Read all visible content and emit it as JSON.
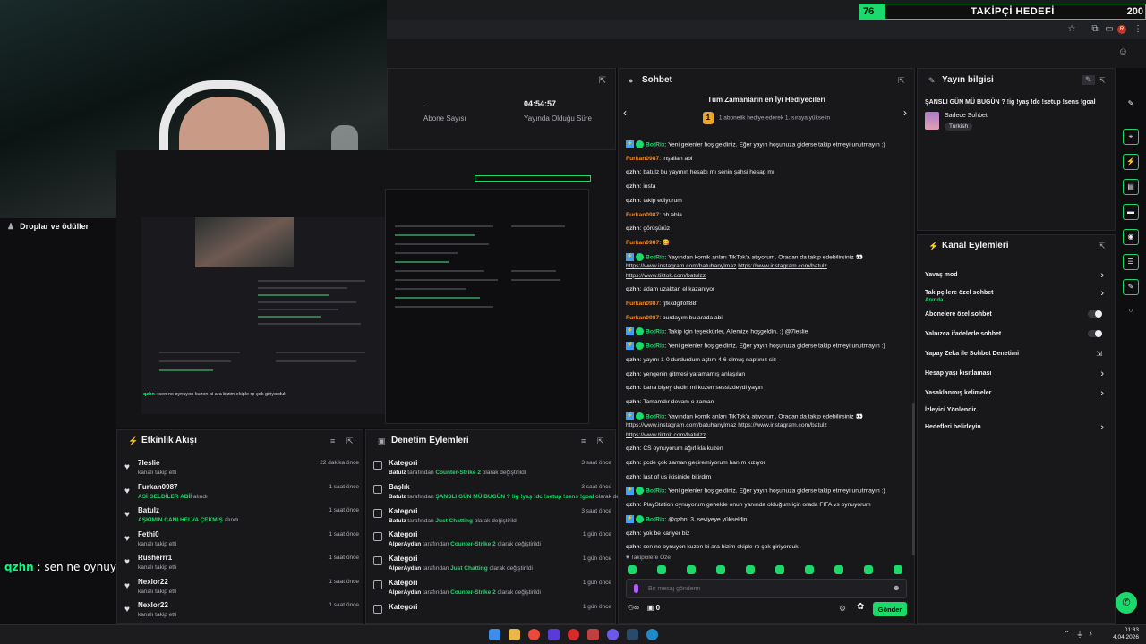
{
  "follow_goal": {
    "current": "76",
    "title": "TAKİPÇİ HEDEFİ",
    "target": "200"
  },
  "drops_label": "Droplar ve ödüller",
  "overlay_chat": {
    "user": "qzhn",
    "text": " : sen ne oynuyon kuzen bi ara bizim ekiple rp çok giriyorduk"
  },
  "stats": {
    "subs_value": "-",
    "subs_label": "Abone Sayısı",
    "live_value": "04:54:57",
    "live_label": "Yayında Olduğu Süre"
  },
  "activity": {
    "title": "Etkinlik Akışı",
    "items": [
      {
        "name": "7leslie",
        "sub": "kanalı takip etti",
        "highlight": "",
        "time": "22 dakika önce"
      },
      {
        "name": "Furkan0987",
        "sub": " alındı",
        "highlight": "ASİ GELDİLER ABİİ",
        "time": "1 saat önce"
      },
      {
        "name": "Batulz",
        "sub": " alındı",
        "highlight": "AŞKIMIN CANI HELVA ÇEKMİŞ",
        "time": "1 saat önce"
      },
      {
        "name": "Fethi0",
        "sub": "kanalı takip etti",
        "highlight": "",
        "time": "1 saat önce"
      },
      {
        "name": "Rusherrr1",
        "sub": "kanalı takip etti",
        "highlight": "",
        "time": "1 saat önce"
      },
      {
        "name": "Nexlor22",
        "sub": "kanalı takip etti",
        "highlight": "",
        "time": "1 saat önce"
      },
      {
        "name": "Nexlor22",
        "sub": "kanalı takip etti",
        "highlight": "",
        "time": "1 saat önce"
      }
    ]
  },
  "moderation": {
    "title": "Denetim Eylemleri",
    "items": [
      {
        "kind": "Kategori",
        "actor": "Batulz",
        "mid": " tarafından ",
        "value": "Counter-Strike 2",
        "tail": " olarak değiştirildi",
        "time": "3 saat önce"
      },
      {
        "kind": "Başlık",
        "actor": "Batulz",
        "mid": " tarafından ",
        "value": "ŞANSLI GÜN MÜ BUGÜN ? !ig !yaş !dc !setup !sens !goal",
        "tail": " olarak değiştirildi",
        "time": "3 saat önce"
      },
      {
        "kind": "Kategori",
        "actor": "Batulz",
        "mid": " tarafından ",
        "value": "Just Chatting",
        "tail": " olarak değiştirildi",
        "time": "3 saat önce"
      },
      {
        "kind": "Kategori",
        "actor": "AlperAydan",
        "mid": " tarafından ",
        "value": "Counter-Strike 2",
        "tail": " olarak değiştirildi",
        "time": "1 gün önce"
      },
      {
        "kind": "Kategori",
        "actor": "AlperAydan",
        "mid": " tarafından ",
        "value": "Just Chatting",
        "tail": " olarak değiştirildi",
        "time": "1 gün önce"
      },
      {
        "kind": "Kategori",
        "actor": "AlperAydan",
        "mid": " tarafından ",
        "value": "Counter-Strike 2",
        "tail": " olarak değiştirildi",
        "time": "1 gün önce"
      },
      {
        "kind": "Kategori",
        "actor": "",
        "mid": "",
        "value": "",
        "tail": "",
        "time": "1 gün önce"
      }
    ]
  },
  "chat": {
    "title": "Sohbet",
    "top_gifters": "Tüm Zamanların en İyi Hediyecileri",
    "gift_rank": "1",
    "gift_text": "1 abonelik hediye ederek 1. sıraya yükselin",
    "sub_only": "Takipçilere Özel",
    "input_placeholder": "Bir mesaj gönderin",
    "points": "0",
    "send_label": "Gönder",
    "messages": [
      {
        "u": "BotRix",
        "t": ": Yeni gelenler hoş geldiniz. Eğer yayın hoşunuza giderse takip etmeyi unutmayın :)",
        "c": "bot"
      },
      {
        "u": "Furkan0987",
        "t": ": inşallah abi",
        "c": "fur"
      },
      {
        "u": "qzhn",
        "t": ": batulz bu yayının hesabı mı senin şahsi hesap mı",
        "c": "qz"
      },
      {
        "u": "qzhn",
        "t": ": insta",
        "c": "qz"
      },
      {
        "u": "qzhn",
        "t": ": takip ediyorum",
        "c": "qz"
      },
      {
        "u": "Furkan0987",
        "t": ": bb abla",
        "c": "fur"
      },
      {
        "u": "qzhn",
        "t": ": görüşürüz",
        "c": "qz"
      },
      {
        "u": "Furkan0987",
        "t": ": 😋",
        "c": "fur"
      },
      {
        "u": "BotRix",
        "t": ": Yayından komik anları TikTok'a atıyorum. Oradan da takip edebilirsiniz 👀",
        "c": "bot",
        "links": [
          "https://www.instagram.com/batuhanylmaz",
          "https://www.instagram.com/batulz",
          "https://www.tiktok.com/batulzz"
        ]
      },
      {
        "u": "qzhn",
        "t": ": adam uzaktan el kazanıyor",
        "c": "qz"
      },
      {
        "u": "Furkan0987",
        "t": ": fjfkkdglfoff88f",
        "c": "fur"
      },
      {
        "u": "Furkan0987",
        "t": ": burdayım bu arada abi",
        "c": "fur"
      },
      {
        "u": "BotRix",
        "t": ": Takip için teşekkürler, Ailemize hoşgeldin. :) @7leslie",
        "c": "bot"
      },
      {
        "u": "BotRix",
        "t": ": Yeni gelenler hoş geldiniz. Eğer yayın hoşunuza giderse takip etmeyi unutmayın :)",
        "c": "bot"
      },
      {
        "u": "qzhn",
        "t": ": yayını 1-0 durdurdum açtım 4-6 olmuş naptınız siz",
        "c": "qz"
      },
      {
        "u": "qzhn",
        "t": ": yengenin gitmesi yaramamış anlaşılan",
        "c": "qz"
      },
      {
        "u": "qzhn",
        "t": ": bana bişey dedin mi kuzen sessizdeydi yayın",
        "c": "qz"
      },
      {
        "u": "qzhn",
        "t": ": Tamamdır devam o zaman",
        "c": "qz"
      },
      {
        "u": "BotRix",
        "t": ": Yayından komik anları TikTok'a atıyorum. Oradan da takip edebilirsiniz 👀",
        "c": "bot",
        "links": [
          "https://www.instagram.com/batuhanylmaz",
          "https://www.instagram.com/batulz",
          "https://www.tiktok.com/batulzz"
        ]
      },
      {
        "u": "qzhn",
        "t": ": CS oynuyorum ağırlıkla kuzen",
        "c": "qz"
      },
      {
        "u": "qzhn",
        "t": ": pcde çok zaman geçiremiyorum hanım kızıyor",
        "c": "qz"
      },
      {
        "u": "qzhn",
        "t": ": last of us ikisinide bitirdim",
        "c": "qz"
      },
      {
        "u": "BotRix",
        "t": ": Yeni gelenler hoş geldiniz. Eğer yayın hoşunuza giderse takip etmeyi unutmayın :)",
        "c": "bot"
      },
      {
        "u": "qzhn",
        "t": ": PlayStation oynuyorum genelde onun yanında olduğum için orada FIFA vs oynuyorum",
        "c": "qz"
      },
      {
        "u": "BotRix",
        "t": ": @qzhn, 3. seviyeye yükseldin.",
        "c": "bot"
      },
      {
        "u": "qzhn",
        "t": ": yok be kariyer biz",
        "c": "qz"
      },
      {
        "u": "qzhn",
        "t": ": sen ne oynuyon kuzen bi ara bizim ekiple rp çok giriyorduk",
        "c": "qz"
      }
    ]
  },
  "stream_info": {
    "title": "Yayın bilgisi",
    "stream_title": "ŞANSLI GÜN MÜ BUGÜN ? !ig !yaş !dc !setup !sens !goal",
    "category": "Sadece Sohbet",
    "language": "Turkish"
  },
  "channel_actions": {
    "title": "Kanal Eylemleri",
    "items": [
      {
        "label": "Yavaş mod",
        "sub": "",
        "ctl": "chev"
      },
      {
        "label": "Takipçilere özel sohbet",
        "sub": "Anında",
        "ctl": "chev"
      },
      {
        "label": "Abonelere özel sohbet",
        "sub": "",
        "ctl": "toggle"
      },
      {
        "label": "Yalnızca ifadelerle sohbet",
        "sub": "",
        "ctl": "toggle"
      },
      {
        "label": "Yapay Zeka ile Sohbet Denetimi",
        "sub": "",
        "ctl": "ext"
      },
      {
        "label": "Hesap yaşı kısıtlaması",
        "sub": "",
        "ctl": "chev"
      },
      {
        "label": "Yasaklanmış kelimeler",
        "sub": "",
        "ctl": "chev"
      },
      {
        "label": "İzleyici Yönlendir",
        "sub": "",
        "ctl": ""
      },
      {
        "label": "Hedefleri belirleyin",
        "sub": "",
        "ctl": "chev"
      }
    ]
  },
  "preview_chat": {
    "user": "qzhn",
    "text": " : sen ne oynuyon kuzen bi ara bizim ekiple rp çok giriyorduk"
  },
  "taskbar": {
    "time": "01:33",
    "date": "4.04.2026"
  },
  "colors": {
    "accent": "#1bd96a",
    "background": "#0e0e10",
    "panel": "#18181b"
  }
}
